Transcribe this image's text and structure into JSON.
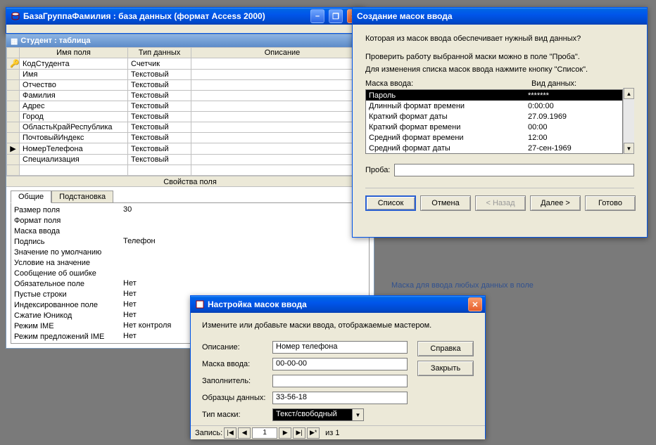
{
  "db_window": {
    "title": "БазаГруппаФамилия : база данных (формат Access 2000)",
    "minimize_glyph": "–",
    "restore_glyph": "❐",
    "close_glyph": "✕",
    "table_window_title": "Студент : таблица",
    "grid": {
      "headers": [
        "Имя поля",
        "Тип данных",
        "Описание"
      ],
      "rows": [
        {
          "marker": "🔑",
          "name": "КодСтудента",
          "type": "Счетчик"
        },
        {
          "marker": "",
          "name": "Имя",
          "type": "Текстовый"
        },
        {
          "marker": "",
          "name": "Отчество",
          "type": "Текстовый"
        },
        {
          "marker": "",
          "name": "Фамилия",
          "type": "Текстовый"
        },
        {
          "marker": "",
          "name": "Адрес",
          "type": "Текстовый"
        },
        {
          "marker": "",
          "name": "Город",
          "type": "Текстовый"
        },
        {
          "marker": "",
          "name": "ОбластьКрайРеспублика",
          "type": "Текстовый"
        },
        {
          "marker": "",
          "name": "ПочтовыйИндекс",
          "type": "Текстовый"
        },
        {
          "marker": "▶",
          "name": "НомерТелефона",
          "type": "Текстовый"
        },
        {
          "marker": "",
          "name": "Специализация",
          "type": "Текстовый"
        }
      ]
    },
    "splitter": "Свойства поля",
    "tabs": [
      "Общие",
      "Подстановка"
    ],
    "props": [
      {
        "label": "Размер поля",
        "value": "30"
      },
      {
        "label": "Формат поля",
        "value": ""
      },
      {
        "label": "Маска ввода",
        "value": "",
        "ellipsis": true
      },
      {
        "label": "Подпись",
        "value": "Телефон"
      },
      {
        "label": "Значение по умолчанию",
        "value": ""
      },
      {
        "label": "Условие на значение",
        "value": ""
      },
      {
        "label": "Сообщение об ошибке",
        "value": ""
      },
      {
        "label": "Обязательное поле",
        "value": "Нет"
      },
      {
        "label": "Пустые строки",
        "value": "Нет"
      },
      {
        "label": "Индексированное поле",
        "value": "Нет"
      },
      {
        "label": "Сжатие Юникод",
        "value": "Нет"
      },
      {
        "label": "Режим IME",
        "value": "Нет контроля"
      },
      {
        "label": "Режим предложений IME",
        "value": "Нет"
      }
    ],
    "hint": "Маска для ввода любых данных в поле"
  },
  "wizard": {
    "title": "Создание масок ввода",
    "p1": "Которая из масок ввода обеспечивает нужный вид данных?",
    "p2": "Проверить работу выбранной маски можно в поле \"Проба\".",
    "p3": "Для изменения списка масок ввода нажмите кнопку \"Список\".",
    "col1": "Маска ввода:",
    "col2": "Вид данных:",
    "rows": [
      {
        "name": "Пароль",
        "sample": "*******",
        "sel": true
      },
      {
        "name": "Длинный формат времени",
        "sample": "0:00:00"
      },
      {
        "name": "Краткий формат даты",
        "sample": "27.09.1969"
      },
      {
        "name": "Краткий формат времени",
        "sample": "00:00"
      },
      {
        "name": "Средний формат времени",
        "sample": "12:00"
      },
      {
        "name": "Средний формат даты",
        "sample": "27-сен-1969"
      }
    ],
    "try_label": "Проба:",
    "btn_list": "Список",
    "btn_cancel": "Отмена",
    "btn_back": "< Назад",
    "btn_next": "Далее >",
    "btn_finish": "Готово"
  },
  "editor": {
    "title": "Настройка масок ввода",
    "intro": "Измените или добавьте маски ввода, отображаемые мастером.",
    "close_glyph": "✕",
    "f_desc_label": "Описание:",
    "f_mask_label": "Маска ввода:",
    "f_place_label": "Заполнитель:",
    "f_sample_label": "Образцы данных:",
    "f_type_label": "Тип маски:",
    "f_desc_val": "Номер телефона",
    "f_mask_val": "00-00-00",
    "f_place_val": "",
    "f_sample_val": "33-56-18",
    "f_type_val": "Текст/свободный",
    "btn_help": "Справка",
    "btn_close": "Закрыть",
    "nav_label": "Запись:",
    "nav_current": "1",
    "nav_of": "из  1"
  }
}
